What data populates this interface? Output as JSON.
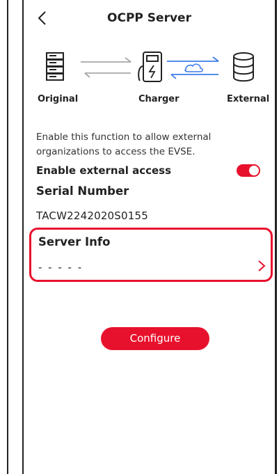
{
  "header": {
    "title": "OCPP Server"
  },
  "diagram": {
    "labels": {
      "original": "Original",
      "charger": "Charger",
      "external": "External"
    },
    "colors": {
      "inactive": "#9a9a9a",
      "active": "#3b7bea",
      "icon": "#222222"
    }
  },
  "description": "Enable this function to allow external organizations to access the EVSE.",
  "enable_access": {
    "label": "Enable external access",
    "enabled": true
  },
  "serial": {
    "label": "Serial Number",
    "value": "TACW2242020S0155"
  },
  "server_info": {
    "label": "Server Info",
    "value": "- - - - -"
  },
  "actions": {
    "configure_label": "Configure"
  },
  "colors": {
    "accent": "#e8112d"
  }
}
